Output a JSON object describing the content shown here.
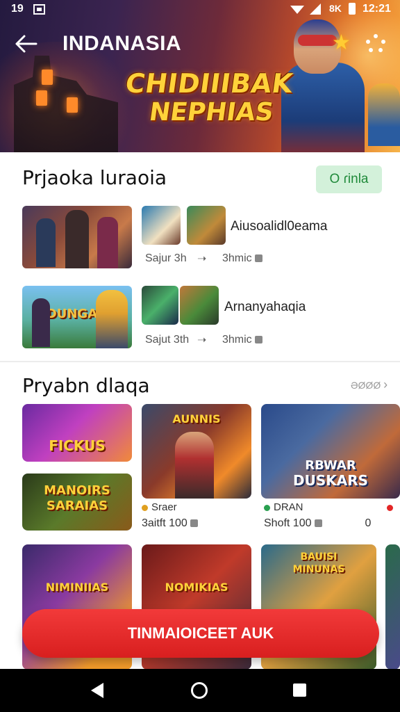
{
  "status_bar": {
    "time": "19",
    "network": "8K",
    "clock": "12:21"
  },
  "app_bar": {
    "title": "INDANASIA"
  },
  "hero": {
    "line1": "CHIDIIIBAK",
    "line2": "NEPHIAS"
  },
  "section1": {
    "title": "Prjaoka luraoia",
    "badge": "O ɾinla",
    "rows": [
      {
        "title": "Aiusoalidl0eama",
        "meta1": "Sajur 3h",
        "meta2": "3hmic"
      },
      {
        "title": "Arnanyahaqia",
        "meta1": "Sajut 3th",
        "meta2": "3hmic"
      }
    ]
  },
  "section2": {
    "title": "Pryabn dlaqa",
    "see_all": "ƏØØØ",
    "art": {
      "a": "FICKUS",
      "b1": "MANOIRS",
      "b2": "SARAIAS",
      "c": "AUNNIS",
      "d1": "RBWAR",
      "d2": "DUSKARS",
      "e": "NIMINIIAS",
      "f": "NOMIKIAS",
      "g1": "BAUISI",
      "g2": "MINUNAS"
    },
    "card_c": {
      "tag": "Sraer",
      "meta": "3aitft 100"
    },
    "card_d": {
      "tag": "DRAN",
      "meta": "Shoft 100"
    },
    "card_e_peek": "0"
  },
  "cta": {
    "label": "TINMAIOICEET AUK"
  },
  "colors": {
    "accent": "#e32626",
    "badge_bg": "#d3f1da",
    "badge_fg": "#1f8a3a",
    "hero_title": "#ffd23a"
  },
  "icons": [
    "back-arrow-icon",
    "more-dots-icon",
    "arrow-right-icon",
    "lock-icon",
    "chevron-right-icon",
    "nav-back-icon",
    "nav-home-icon",
    "nav-recents-icon"
  ]
}
